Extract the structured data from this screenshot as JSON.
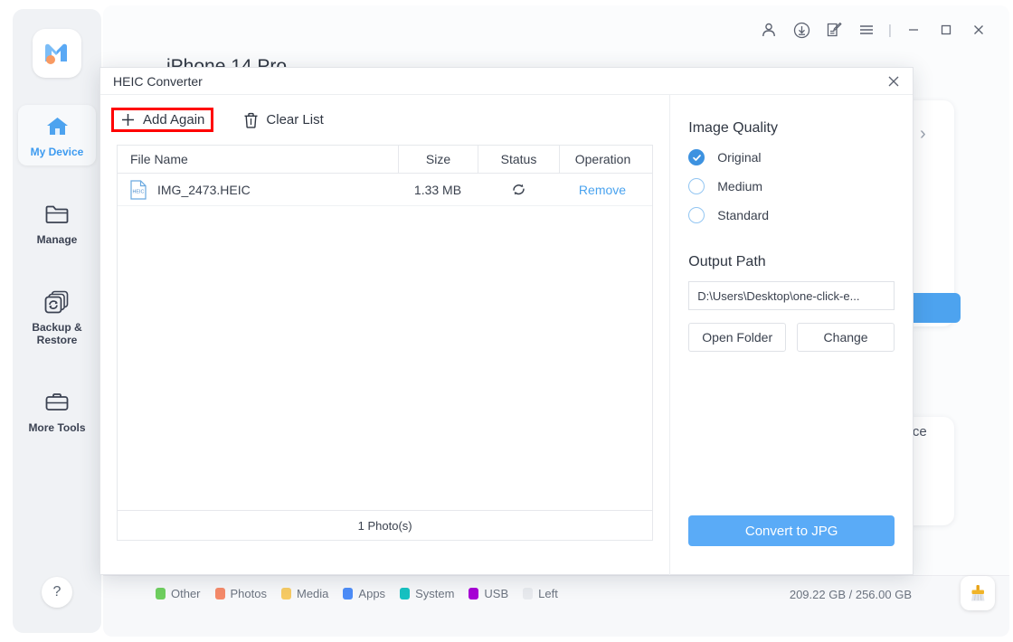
{
  "app": {
    "logo_icon": "brand-m-logo",
    "background_page_title": "iPhone 14 Pro"
  },
  "titlebar": {
    "buttons": [
      {
        "name": "account",
        "icon": "user-icon"
      },
      {
        "name": "download",
        "icon": "download-circle-icon"
      },
      {
        "name": "feedback",
        "icon": "note-edit-icon"
      },
      {
        "name": "menu",
        "icon": "hamburger-menu-icon"
      }
    ],
    "separator": "|",
    "minimize": "minimize-icon",
    "maximize": "maximize-icon",
    "close": "close-icon"
  },
  "sidebar": {
    "items": [
      {
        "label": "My Device",
        "icon": "home-icon",
        "active": true
      },
      {
        "label": "Manage",
        "icon": "folder-icon",
        "active": false
      },
      {
        "label": "Backup & Restore",
        "icon": "backup-restore-icon",
        "active": false
      },
      {
        "label": "More Tools",
        "icon": "toolbox-icon",
        "active": false
      }
    ],
    "help_label": "?"
  },
  "background": {
    "edit_icon": "pencil-edit-icon",
    "chevron_icon": "chevron-right-icon",
    "partial_text": "vice"
  },
  "statusbar": {
    "legend": [
      {
        "label": "Other",
        "color": "#6fcf5f"
      },
      {
        "label": "Photos",
        "color": "#f58a6a"
      },
      {
        "label": "Media",
        "color": "#f7cb64"
      },
      {
        "label": "Apps",
        "color": "#4d8df8"
      },
      {
        "label": "System",
        "color": "#16c2c2"
      },
      {
        "label": "USB",
        "color": "#a800d6"
      },
      {
        "label": "Left",
        "color": "#e8eaee"
      }
    ],
    "storage": "209.22 GB / 256.00 GB",
    "cleanup_icon": "broom-cleanup-icon"
  },
  "dialog": {
    "title": "HEIC Converter",
    "close_icon": "close-icon",
    "toolbar": {
      "add_again": "Add Again",
      "add_icon": "plus-icon",
      "clear_list": "Clear List",
      "clear_icon": "trash-icon"
    },
    "table": {
      "columns": [
        "File Name",
        "Size",
        "Status",
        "Operation"
      ],
      "rows": [
        {
          "file_icon": "heic-file-icon",
          "file_icon_label": "HEIC",
          "name": "IMG_2473.HEIC",
          "size": "1.33 MB",
          "status_icon": "refresh-sync-icon",
          "operation": "Remove"
        }
      ],
      "footer": "1 Photo(s)"
    },
    "quality": {
      "title": "Image Quality",
      "options": [
        {
          "label": "Original",
          "selected": true
        },
        {
          "label": "Medium",
          "selected": false
        },
        {
          "label": "Standard",
          "selected": false
        }
      ]
    },
    "output": {
      "title": "Output Path",
      "path": "D:\\Users\\Desktop\\one-click-e...",
      "open_folder": "Open Folder",
      "change": "Change"
    },
    "convert_button": "Convert to JPG"
  },
  "colors": {
    "accent_blue": "#5aabf7",
    "radio_blue": "#3d92e0",
    "link_blue": "#4aa3ef",
    "highlight_red": "#ff0000"
  }
}
